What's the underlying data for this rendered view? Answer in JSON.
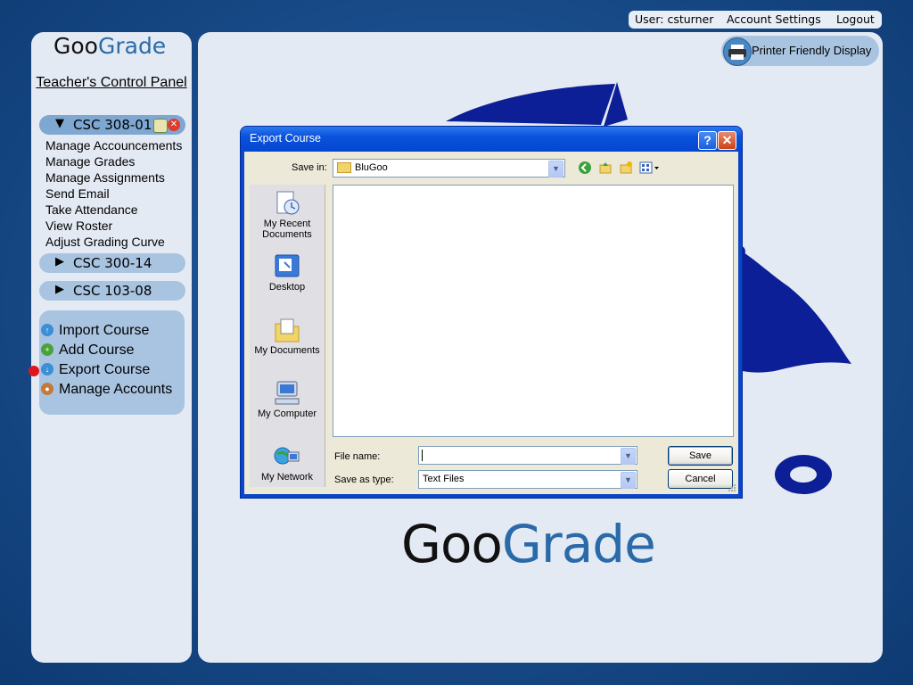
{
  "topbar": {
    "user": "User: csturner",
    "account_settings": "Account Settings",
    "logout": "Logout"
  },
  "sidebar": {
    "logo": {
      "part1": "Goo",
      "part2": "Grade"
    },
    "title": "Teacher's Control Panel",
    "courses": [
      {
        "label": "CSC 308-01",
        "expanded": true
      },
      {
        "label": "CSC 300-14",
        "expanded": false
      },
      {
        "label": "CSC 103-08",
        "expanded": false
      }
    ],
    "course_menu": [
      "Manage Accouncements",
      "Manage Grades",
      "Manage Assignments",
      "Send Email",
      "Take Attendance",
      "View Roster",
      "Adjust Grading Curve"
    ],
    "actions": [
      {
        "label": "Import Course",
        "icon": "import-icon"
      },
      {
        "label": "Add Course",
        "icon": "add-icon"
      },
      {
        "label": "Export Course",
        "icon": "export-icon"
      },
      {
        "label": "Manage Accounts",
        "icon": "accounts-icon"
      }
    ]
  },
  "main": {
    "printer_label": "Printer Friendly Display",
    "logo": {
      "part1": "Goo",
      "part2": "Grade"
    }
  },
  "dialog": {
    "title": "Export Course",
    "save_in_label": "Save in:",
    "save_in_value": "BluGoo",
    "places": [
      "My Recent Documents",
      "Desktop",
      "My Documents",
      "My Computer",
      "My Network"
    ],
    "file_name_label": "File name:",
    "file_name_value": "",
    "save_type_label": "Save as type:",
    "save_type_value": "Text Files",
    "save_button": "Save",
    "cancel_button": "Cancel"
  },
  "colors": {
    "brand_blue": "#2a6aa9",
    "panel_bg": "#e4eaf3",
    "accent_bar": "#a9c4e1",
    "dialog_blue": "#0a46c8",
    "decor_navy": "#0c1f96"
  }
}
